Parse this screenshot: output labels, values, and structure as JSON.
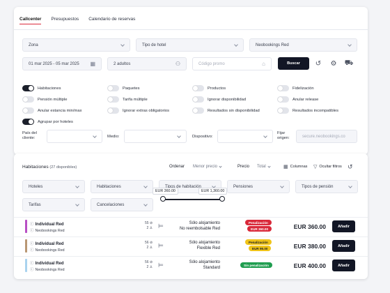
{
  "tabs": [
    {
      "label": "Callcenter",
      "active": true
    },
    {
      "label": "Presupuestos",
      "active": false
    },
    {
      "label": "Calendario de reservas",
      "active": false
    }
  ],
  "search": {
    "zona": "Zona",
    "tipo_hotel": "Tipo de hotel",
    "cadena": "Neobookings Red",
    "fechas": "01 mar 2025 - 05 mar 2025",
    "ocupacion": "2 adultos",
    "promo_placeholder": "Código promo",
    "buscar_label": "Buscar"
  },
  "toggles": [
    {
      "label": "Habitaciones",
      "on": true
    },
    {
      "label": "Pensión múltiple",
      "on": false
    },
    {
      "label": "Anular estancia min/max",
      "on": false
    },
    {
      "label": "Agrupar por hoteles",
      "on": true
    },
    {
      "label": "Paquetes",
      "on": false
    },
    {
      "label": "Tarifa múltiple",
      "on": false
    },
    {
      "label": "Ignorar extras obligatorios",
      "on": false
    },
    {
      "label": "Productos",
      "on": false
    },
    {
      "label": "Ignorar disponibilidad",
      "on": false
    },
    {
      "label": "Resultados sin disponibilidad",
      "on": false
    },
    {
      "label": "Fidelización",
      "on": false
    },
    {
      "label": "Anular release",
      "on": false
    },
    {
      "label": "Resultados incompatibles",
      "on": false
    }
  ],
  "filters": {
    "pais_label": "País del cliente:",
    "medio_label": "Medio:",
    "dispositivo_label": "Dispositivo:",
    "fijar_origen_label": "Fijar origen:",
    "origen_value": "secure.neobookings.co"
  },
  "results": {
    "title": "Habitaciones",
    "count": "(27 disponibles)",
    "ordenar_label": "Ordenar",
    "ordenar_value": "Menor precio",
    "precio_label": "Precio",
    "precio_value": "Total",
    "columnas_label": "Columnas",
    "ocultar_label": "Ocultar filtros",
    "filter_fields": [
      "Hoteles",
      "Habitaciones",
      "Tipos de habitación",
      "Pensiones",
      "Tipos de pensión",
      "Tarifas",
      "Cancelaciones"
    ],
    "range_min": "EUR 360.00",
    "range_max": "EUR 1,360.00"
  },
  "rows": [
    {
      "color": "#b84fc4",
      "name": "Individual Red",
      "provider": "Neobookings Red",
      "pax_top": "55",
      "pax_bottom": "2",
      "rate": "Sólo alojamiento",
      "condition": "No reembolsable Red",
      "badge": "Penalización",
      "badge2": "EUR 360.00",
      "badge_color": "#d9293a",
      "price": "EUR 360.00",
      "button": "Añadir"
    },
    {
      "color": "#b99773",
      "name": "Individual Red",
      "provider": "Neobookings Red",
      "pax_top": "56",
      "pax_bottom": "2",
      "rate": "Sólo alojamiento",
      "condition": "Flexible Red",
      "badge": "Penalización",
      "badge2": "EUR 95.00",
      "badge_color": "#f0c419",
      "price": "EUR 380.00",
      "button": "Añadir"
    },
    {
      "color": "#a9d3ef",
      "name": "Individual Red",
      "provider": "Neobookings Red",
      "pax_top": "56",
      "pax_bottom": "2",
      "rate": "Sólo alojamiento",
      "condition": "Standard",
      "badge": "Sin penalización",
      "badge2": "",
      "badge_color": "#1f9d4f",
      "price": "EUR 400.00",
      "button": "Añadir"
    }
  ]
}
